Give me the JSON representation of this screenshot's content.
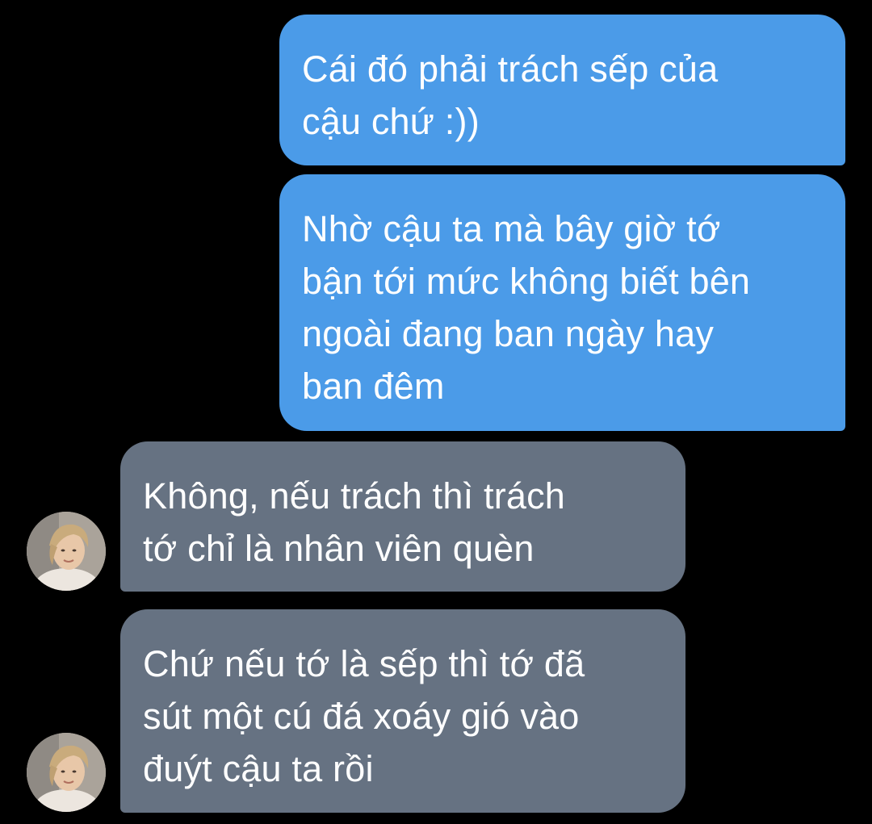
{
  "conversation": {
    "messages": [
      {
        "direction": "outgoing",
        "lines": [
          "Cái đó phải trách sếp của",
          "cậu chứ :))"
        ]
      },
      {
        "direction": "outgoing",
        "lines": [
          "Nhờ cậu ta mà bây giờ tớ",
          "bận tới mức không biết bên",
          "ngoài đang ban ngày hay",
          "ban đêm"
        ]
      },
      {
        "direction": "incoming",
        "lines": [
          "Không, nếu trách thì trách",
          "tớ chỉ là nhân viên quèn"
        ]
      },
      {
        "direction": "incoming",
        "lines": [
          "Chứ nếu tớ là sếp thì tớ đã",
          "sút một cú đá xoáy gió vào",
          "đuýt cậu ta rồi"
        ]
      }
    ]
  },
  "colors": {
    "background": "#000000",
    "outgoing_bubble": "#4b9be8",
    "incoming_bubble": "#667282",
    "text": "#ffffff"
  }
}
